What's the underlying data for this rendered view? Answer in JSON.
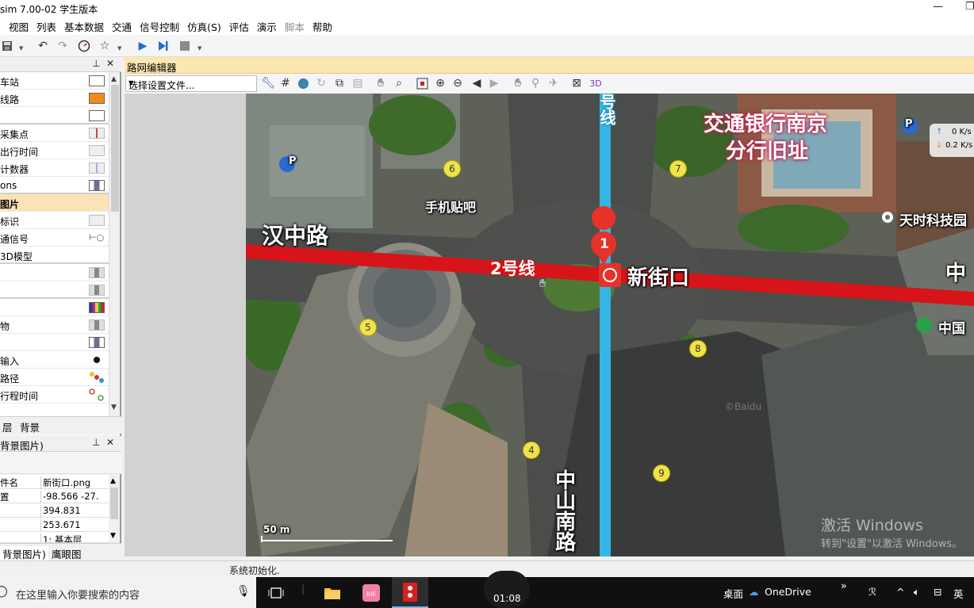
{
  "window": {
    "title": "sim 7.00-02 学生版本",
    "minimize": "—",
    "restore": "❐"
  },
  "menu": [
    "视图",
    "列表",
    "基本数据",
    "交通",
    "信号控制",
    "仿真(S)",
    "评估",
    "演示",
    "脚本",
    "帮助"
  ],
  "menu_disabled": [
    "脚本"
  ],
  "toolbar_icons": [
    "save-icon",
    "undo-icon",
    "redo-icon",
    "gauge-icon",
    "star-icon",
    "play-icon",
    "step-icon",
    "stop-icon"
  ],
  "left_panel": {
    "network_objects": [
      {
        "label": "车站",
        "swatch": "#ffffff"
      },
      {
        "label": "线路",
        "swatch": "#f28a1e"
      },
      {
        "label": "",
        "swatch": "#ffffff"
      },
      {
        "label": "采集点",
        "swatch": "#e6e6e6"
      },
      {
        "label": "出行时间",
        "swatch": "#e6e6e6"
      },
      {
        "label": "计数器",
        "swatch": "#e6e6e6"
      },
      {
        "label": "ons",
        "swatch": "#8a8fa8"
      },
      {
        "label": "图片",
        "swatch": "#ffffff",
        "selected": true
      },
      {
        "label": "标识",
        "swatch": "#e6e6e6"
      },
      {
        "label": "通信号",
        "swatch": "#ffffff"
      },
      {
        "label": "3D模型",
        "swatch": "#ffffff"
      },
      {
        "label": "",
        "swatch": "#aaaaaa"
      },
      {
        "label": "",
        "swatch": "#aaaaaa"
      },
      {
        "label": "",
        "swatch": "#c0209a"
      },
      {
        "label": "物",
        "swatch": "#aaaaaa"
      },
      {
        "label": "",
        "swatch": "#8a8fa8"
      },
      {
        "label": "输入",
        "swatch": "#ffffff"
      },
      {
        "label": "路径",
        "swatch": "#e8c43a"
      },
      {
        "label": "行程时间",
        "swatch": "#ffffff"
      }
    ],
    "tabs": [
      "层",
      "背景"
    ],
    "props_title": "背景图片)",
    "props": [
      {
        "key": "件名",
        "value": "新街口.png"
      },
      {
        "key": "置",
        "value": "-98.566 -27."
      },
      {
        "key": "",
        "value": "394.831"
      },
      {
        "key": "",
        "value": "253.671"
      },
      {
        "key": "",
        "value": "1: 基本层"
      }
    ],
    "bottom_tabs": [
      "背景图片)",
      "鹰眼图"
    ]
  },
  "editor": {
    "title": "路网编辑器",
    "settings_placeholder": "选择设置文件..."
  },
  "map": {
    "labels": {
      "bank": "交通银行南京",
      "bank2": "分行旧址",
      "hanzhong": "汉中路",
      "line2": "2号线",
      "xinjiekou": "新街口",
      "shouji": "手机贴吧",
      "tianshi": "天时科技园",
      "zhong": "中",
      "zhongguo": "中国",
      "zhongshannan": "中山南路",
      "line1": "号线",
      "pin": "1",
      "scale": "50 m",
      "watermark1": "激活 Windows",
      "watermark2": "转到\"设置\"以激活 Windows。",
      "baidu": "©Baidu",
      "parking": "P"
    },
    "poi_numbers": [
      "6",
      "7",
      "5",
      "8",
      "4",
      "9"
    ],
    "speed": {
      "up": "0 K/s",
      "down": "0.2 K/s"
    },
    "colors": {
      "metro_line_2": "#d7141a",
      "metro_line_1": "#35b5e5",
      "pin": "#e6332a"
    }
  },
  "status": {
    "text": "系统初始化."
  },
  "taskbar": {
    "search_placeholder": "在这里输入你要搜索的内容",
    "clock": "01:08",
    "desktop": "桌面",
    "onedrive": "OneDrive",
    "lang": "英"
  }
}
